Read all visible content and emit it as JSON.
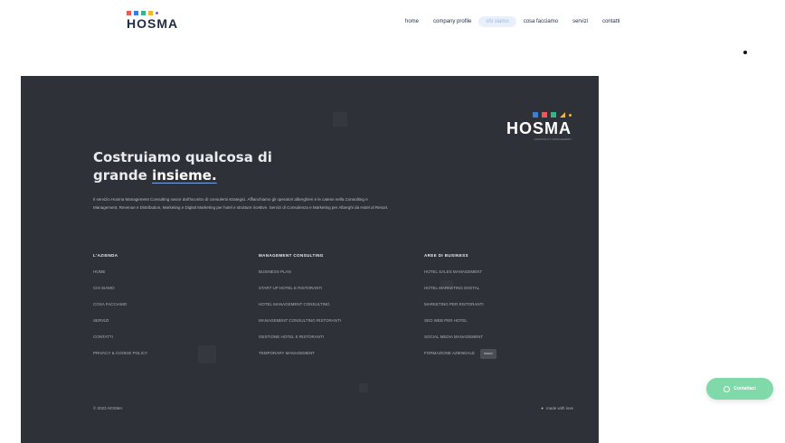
{
  "header": {
    "brand": "HOSMA",
    "logo_colors": [
      "#e65a5a",
      "#3b7fd9",
      "#3bb08a",
      "#f2b632",
      "#8b5bd6"
    ],
    "nav": [
      {
        "label": "home",
        "active": false
      },
      {
        "label": "company profile",
        "active": false
      },
      {
        "label": "chi siamo",
        "active": true
      },
      {
        "label": "cosa facciamo",
        "active": false
      },
      {
        "label": "servizi",
        "active": false
      },
      {
        "label": "contatti",
        "active": false
      }
    ]
  },
  "footer": {
    "brand": "HOSMA",
    "brand_tagline": "HOSPITALITY MANAGEMENT",
    "headline_line1": "Costruiamo qualcosa di",
    "headline_line2_prefix": "grande ",
    "headline_line2_emph": "insieme.",
    "description": "Il servizio Hosma Management Consulting nasce dall'incontro di consulenti strategici. Affianchiamo gli operatori alberghieri e le catene nella Consulting e Management, Revenue e Distribution, Marketing e Digital Marketing per hotel e strutture ricettive. Servizi di Consulenza e Marketing per Alberghi da Hotel al Resort.",
    "columns": [
      {
        "title": "L'AZIENDA",
        "links": [
          {
            "label": "HOME"
          },
          {
            "label": "CHI SIAMO"
          },
          {
            "label": "COSA FACCIAMO"
          },
          {
            "label": "SERVIZI"
          },
          {
            "label": "CONTATTI"
          },
          {
            "label": "PRIVACY & COOKIE POLICY"
          }
        ]
      },
      {
        "title": "MANAGEMENT CONSULTING",
        "links": [
          {
            "label": "BUSINESS PLAN"
          },
          {
            "label": "START UP HOTEL E RISTORANTI"
          },
          {
            "label": "HOTEL MANAGEMENT CONSULTING"
          },
          {
            "label": "MANAGEMENT CONSULTING RISTORANTI"
          },
          {
            "label": "GESTIONE HOTEL E RISTORANTI"
          },
          {
            "label": "TEMPORARY MANAGEMENT"
          }
        ]
      },
      {
        "title": "AREE DI BUSINESS",
        "links": [
          {
            "label": "HOTEL SALES MANAGEMENT",
            "badge": ""
          },
          {
            "label": "HOTEL MARKETING DIGITAL",
            "badge": ""
          },
          {
            "label": "MARKETING PER RISTORANTI",
            "badge": ""
          },
          {
            "label": "SEO WEB PER HOTEL",
            "badge": ""
          },
          {
            "label": "SOCIAL MEDIA MANAGEMENT",
            "badge": ""
          },
          {
            "label": "FORMAZIONE AZIENDALE",
            "badge": "nuovo"
          }
        ]
      }
    ],
    "copyright": "© 2023 HOSMA",
    "made_with": "made with love"
  },
  "chat_button": {
    "label": "Contattaci"
  },
  "colors": {
    "footer_bg": "#2f3138",
    "accent": "#7aa7e8",
    "chat_bg": "#7fd9a8"
  }
}
